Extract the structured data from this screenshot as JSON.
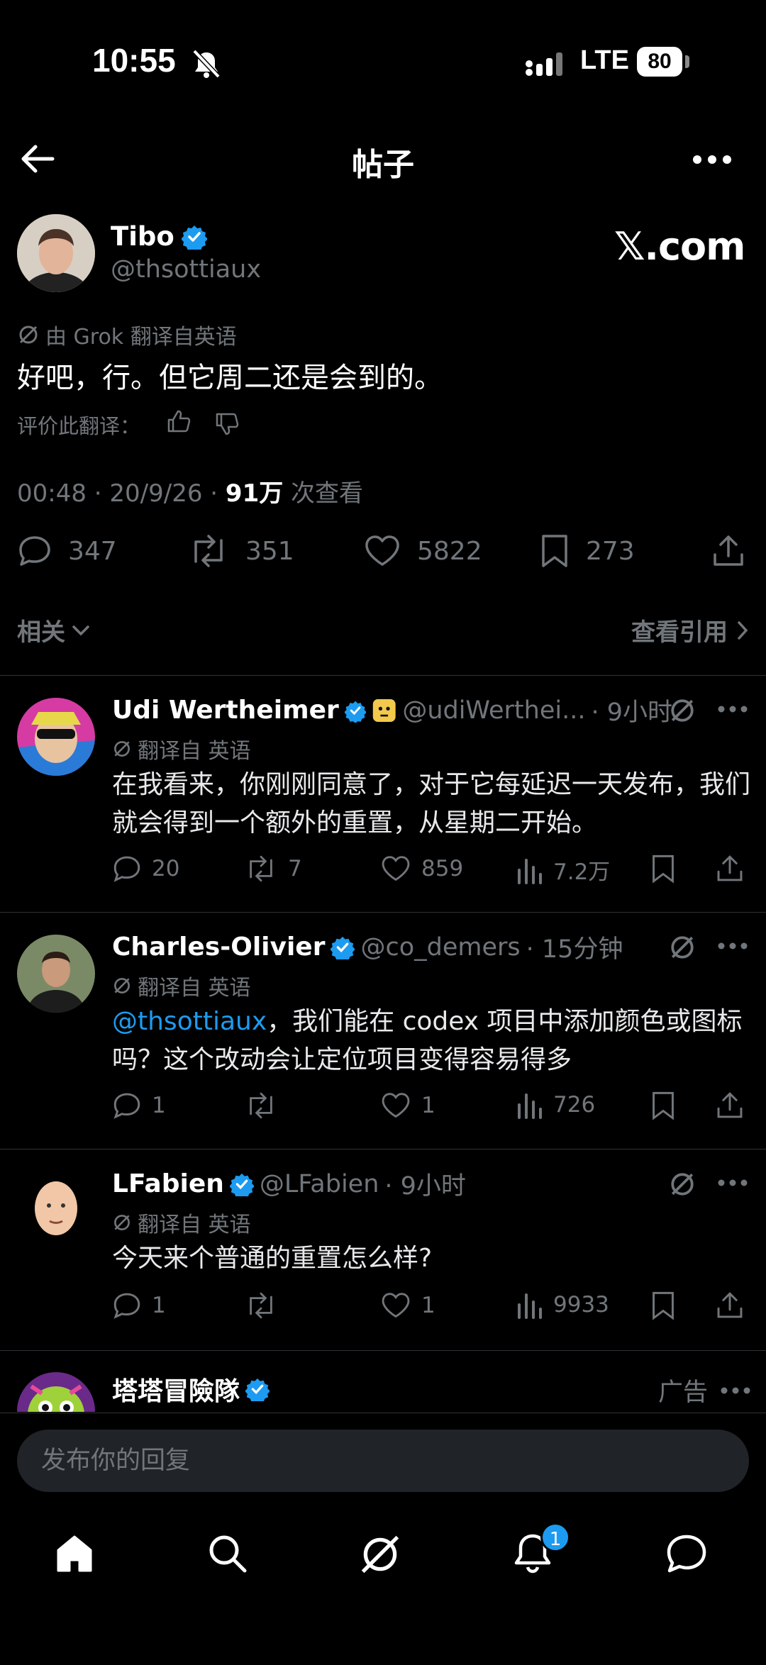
{
  "status_bar": {
    "time": "10:55",
    "network": "LTE",
    "battery": "80"
  },
  "header": {
    "title": "帖子"
  },
  "main_post": {
    "name": "Tibo",
    "handle": "@thsottiaux",
    "brand": "𝕏.com",
    "translated_note": "由 Grok 翻译自英语",
    "text": "好吧，行。但它周二还是会到的。",
    "rate_label": "评价此翻译：",
    "timestamp": "00:48 · 20/9/26 · ",
    "views_count": "91万",
    "views_label": " 次查看",
    "replies": "347",
    "reposts": "351",
    "likes": "5822",
    "bookmarks": "273"
  },
  "related": {
    "label": "相关",
    "quotes_label": "查看引用"
  },
  "replies": [
    {
      "name": "Udi Wertheimer",
      "handle": "@udiWerthei...",
      "time": "· 9小时",
      "translated": "翻译自 英语",
      "text": "在我看来，你刚刚同意了，对于它每延迟一天发布，我们就会得到一个额外的重置，从星期二开始。",
      "replies": "20",
      "reposts": "7",
      "likes": "859",
      "views": "7.2万"
    },
    {
      "name": "Charles-Olivier",
      "handle": "@co_demers",
      "time": "· 15分钟",
      "translated": "翻译自 英语",
      "mention": "@thsottiaux",
      "text": "，我们能在 codex 项目中添加颜色或图标吗？这个改动会让定位项目变得容易得多",
      "replies": "1",
      "reposts": "",
      "likes": "1",
      "views": "726"
    },
    {
      "name": "LFabien",
      "handle": "@LFabien",
      "time": "· 9小时",
      "translated": "翻译自 英语",
      "text": "今天来个普通的重置怎么样?",
      "replies": "1",
      "reposts": "",
      "likes": "1",
      "views": "9933"
    }
  ],
  "ad": {
    "name": "塔塔冒險隊",
    "label": "广告"
  },
  "composer": {
    "placeholder": "发布你的回复"
  },
  "nav": {
    "notifications_badge": "1"
  },
  "colors": {
    "accent": "#1d9bf0",
    "background": "#000000",
    "muted": "#71767b"
  }
}
